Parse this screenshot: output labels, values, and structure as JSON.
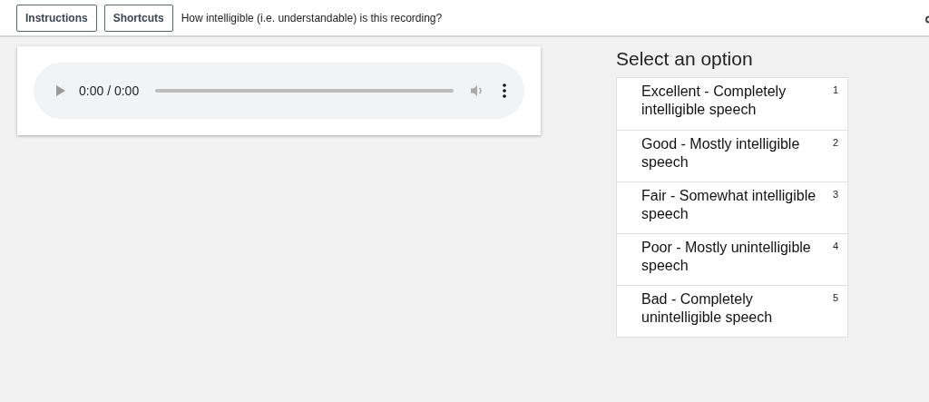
{
  "toolbar": {
    "buttons": [
      "Instructions",
      "Shortcuts"
    ],
    "question": "How intelligible (i.e. understandable) is this recording?"
  },
  "audio_player": {
    "time": "0:00 / 0:00"
  },
  "options_panel": {
    "title": "Select an option",
    "options": [
      {
        "label": "Excellent - Completely intelligible speech",
        "shortcut": "1",
        "selected": false
      },
      {
        "label": "Good - Mostly intelligible speech",
        "shortcut": "2",
        "selected": false
      },
      {
        "label": "Fair - Somewhat intelligible speech",
        "shortcut": "3",
        "selected": false
      },
      {
        "label": "Poor - Mostly unintelligible speech",
        "shortcut": "4",
        "selected": false
      },
      {
        "label": "Bad - Completely unintelligible speech",
        "shortcut": "5",
        "selected": false
      }
    ]
  }
}
